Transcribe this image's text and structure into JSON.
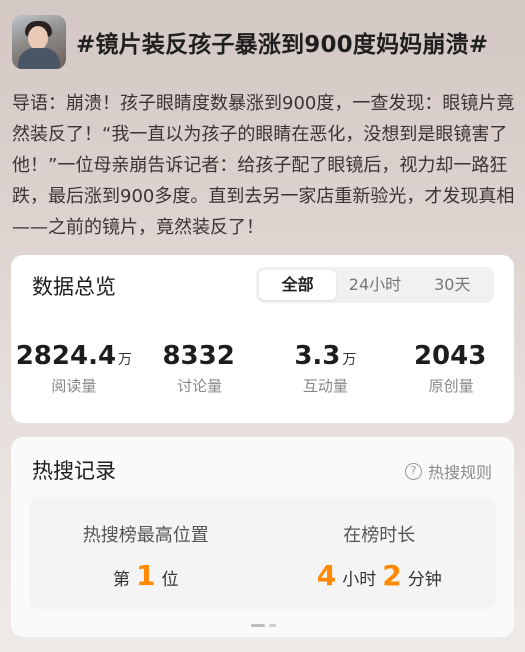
{
  "topic": {
    "title": "#镜片装反孩子暴涨到900度妈妈崩溃#"
  },
  "lead": {
    "text": "导语：崩溃！孩子眼睛度数暴涨到900度，一查发现：眼镜片竟然装反了！“我一直以为孩子的眼睛在恶化，没想到是眼镜害了他！”一位母亲崩告诉记者：给孩子配了眼镜后，视力却一路狂跌，最后涨到900多度。直到去另一家店重新验光，才发现真相——之前的镜片，竟然装反了！"
  },
  "overview": {
    "heading": "数据总览",
    "tabs": [
      "全部",
      "24小时",
      "30天"
    ],
    "active_tab": "全部",
    "stats": [
      {
        "value": "2824.4",
        "unit": "万",
        "label": "阅读量"
      },
      {
        "value": "8332",
        "unit": "",
        "label": "讨论量"
      },
      {
        "value": "3.3",
        "unit": "万",
        "label": "互动量"
      },
      {
        "value": "2043",
        "unit": "",
        "label": "原创量"
      }
    ]
  },
  "hot": {
    "heading": "热搜记录",
    "rules_label": "热搜规则",
    "highest_position": {
      "label": "热搜榜最高位置",
      "prefix": "第",
      "value": "1",
      "suffix": "位"
    },
    "duration": {
      "label": "在榜时长",
      "hours": "4",
      "hours_unit": "小时",
      "minutes": "2",
      "minutes_unit": "分钟"
    }
  },
  "colors": {
    "accent": "#ff8a00"
  }
}
